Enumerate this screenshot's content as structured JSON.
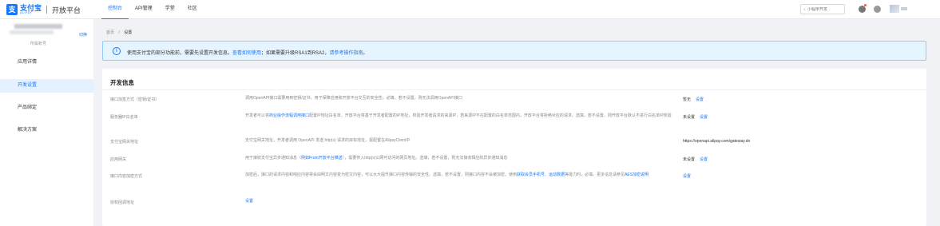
{
  "header": {
    "logo_cn": "支付宝",
    "logo_en": "ALIPAY",
    "platform": "开放平台",
    "nav": [
      "控制台",
      "API管理",
      "学堂",
      "社区"
    ],
    "search_placeholder": "小程序开发"
  },
  "sidebar": {
    "switch_label": "切换",
    "account_label": "所属账号",
    "items": [
      "应用详情",
      "开发设置",
      "产品绑定",
      "解决方案"
    ]
  },
  "breadcrumb": {
    "home": "首页",
    "sep": "/",
    "current": "设置"
  },
  "notice": {
    "text1": "使用支付宝的部分功能前，需要先设置开发信息。",
    "link1": "查看如何使用",
    "text2": "；如果需要升级RSA1到RSA2，",
    "link2": "请参考操作指南",
    "text3": "。"
  },
  "section": {
    "title": "开发信息",
    "rows": [
      {
        "label": "接口加签方式（密钥/证书）",
        "desc": "调用OpenAPI接口需要用到密钥/证书，用于保障应用和开放平台交互的安全性。必填，若不设置，则无法调用OpenAPI接口",
        "status": "暂无",
        "action": "设置"
      },
      {
        "label": "服务器IP白名单",
        "desc_a": "开发者可以将",
        "desc_link": "商业操作流程调用接口",
        "desc_b": "配置IP地址白名单，开放平台将基于开发者配置的IP地址，校验开发者请求的来源IP，若来源IP不在配置的白名单范围内，开放平台将拒绝对应的请求。选填，若不设置，则开放平台默认不进行白名单IP校验",
        "status": "未设置",
        "action": "设置"
      },
      {
        "label": "支付宝网关地址",
        "desc": "支付宝网关地址，开发者调用 OpenAPI 发送 http(s) 请求的目标地址，需配置在AlipayClient中",
        "status": "https://openapi.alipay.com/gateway.do"
      },
      {
        "label": "应用网关",
        "desc_a": "用于接收支付宝异步通知消息（",
        "desc_link": "例如From开放平台推送",
        "desc_b": "），需要传入http(s)公网可访问的网页地址。选填，若不设置，则无法接收相应的异步通知消息",
        "status": "未设置",
        "action": "设置"
      },
      {
        "label": "接口内容加密方式",
        "desc_a": "加密后，接口的请求内容和响应内容将会由明文内容变为密文内容，可以大大提升接口内容传输的安全性。选填，若不设置，则接口内容不会被加密。使用",
        "desc_link1": "获取会员手机号",
        "desc_mid": "、",
        "desc_link2": "运动数据",
        "desc_b": "等能力时，必填。更多信息请参见",
        "desc_link3": "AES加密说明",
        "action": "设置"
      },
      {
        "label": "授权回调地址",
        "action": "设置"
      }
    ]
  },
  "colors": {
    "primary": "#1677ff",
    "notice_bg": "#e6f4ff",
    "page_bg": "#f0f2f5"
  }
}
